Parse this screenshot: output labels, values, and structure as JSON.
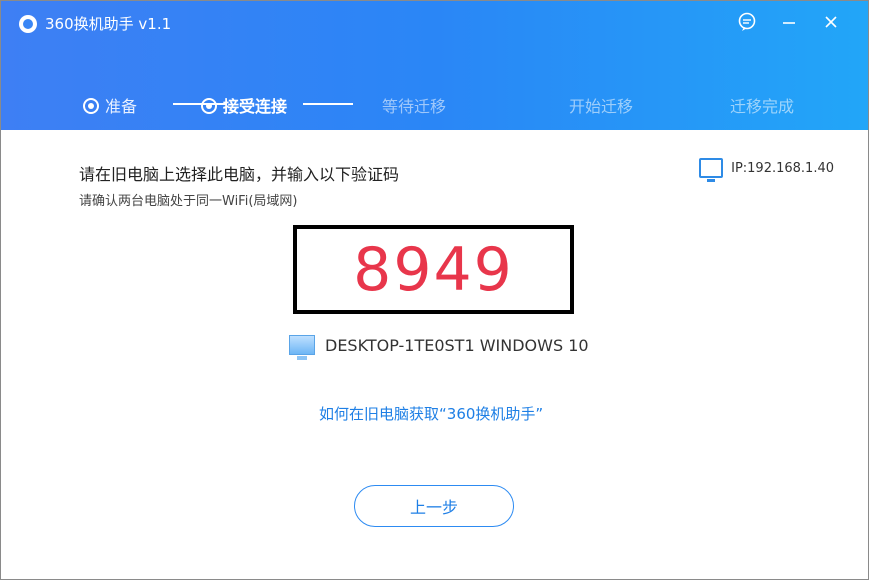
{
  "app": {
    "title": "360换机助手 v1.1"
  },
  "window_controls": {
    "feedback_icon": "chat-bubble",
    "minimize_icon": "minus",
    "close_icon": "x"
  },
  "steps": [
    {
      "label": "准备",
      "state": "done"
    },
    {
      "label": "接受连接",
      "state": "active"
    },
    {
      "label": "等待迁移",
      "state": "pending"
    },
    {
      "label": "开始迁移",
      "state": "pending"
    },
    {
      "label": "迁移完成",
      "state": "pending"
    }
  ],
  "instructions": {
    "title": "请在旧电脑上选择此电脑，并输入以下验证码",
    "subtitle": "请确认两台电脑处于同一WiFi(局域网)"
  },
  "ip": {
    "label": "IP:192.168.1.40"
  },
  "verification": {
    "code": "8949"
  },
  "device": {
    "name": "DESKTOP-1TE0ST1 WINDOWS 10"
  },
  "help_link": "如何在旧电脑获取“360换机助手”",
  "buttons": {
    "back": "上一步"
  },
  "colors": {
    "header_start": "#3e7ff4",
    "header_end": "#22a6f8",
    "code": "#e8364b",
    "link": "#1e7fe5"
  }
}
